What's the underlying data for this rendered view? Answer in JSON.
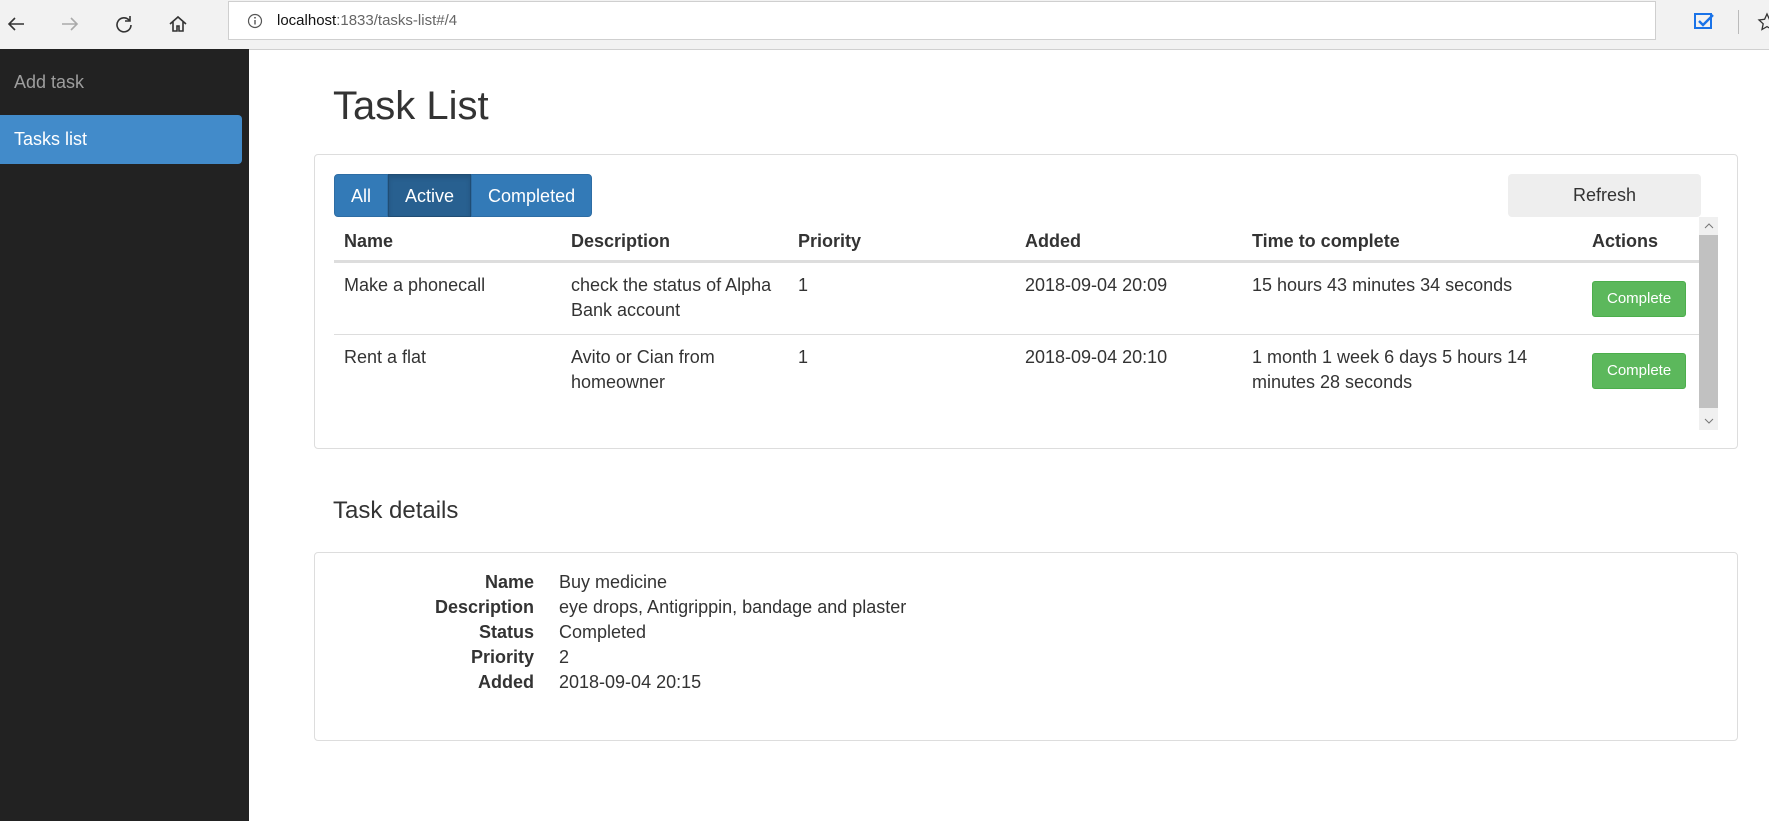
{
  "browser": {
    "url_host": "localhost",
    "url_rest": ":1833/tasks-list#/4"
  },
  "sidebar": {
    "items": [
      {
        "label": "Add task"
      },
      {
        "label": "Tasks list"
      }
    ]
  },
  "main": {
    "title": "Task List",
    "filters": [
      "All",
      "Active",
      "Completed"
    ],
    "active_filter": "Active",
    "refresh_label": "Refresh",
    "table": {
      "headers": [
        "Name",
        "Description",
        "Priority",
        "Added",
        "Time to complete",
        "Actions"
      ],
      "rows": [
        {
          "name": "Make a phonecall",
          "description": "check the status of Alpha Bank account",
          "priority": "1",
          "added": "2018-09-04 20:09",
          "time": "15 hours 43 minutes 34 seconds",
          "action": "Complete"
        },
        {
          "name": "Rent a flat",
          "description": "Avito or Cian from homeowner",
          "priority": "1",
          "added": "2018-09-04 20:10",
          "time": "1 month 1 week 6 days 5 hours 14 minutes 28 seconds",
          "action": "Complete"
        }
      ]
    }
  },
  "details": {
    "title": "Task details",
    "fields": [
      {
        "label": "Name",
        "value": "Buy medicine"
      },
      {
        "label": "Description",
        "value": "eye drops, Antigrippin, bandage and plaster"
      },
      {
        "label": "Status",
        "value": "Completed"
      },
      {
        "label": "Priority",
        "value": "2"
      },
      {
        "label": "Added",
        "value": "2018-09-04 20:15"
      }
    ]
  },
  "colors": {
    "sidebar_bg": "#222222",
    "primary": "#337ab7",
    "success": "#5cb85c"
  },
  "icons": [
    "back-arrow-icon",
    "forward-arrow-icon",
    "refresh-icon",
    "home-icon",
    "info-icon",
    "extension-icon",
    "star-icon"
  ]
}
